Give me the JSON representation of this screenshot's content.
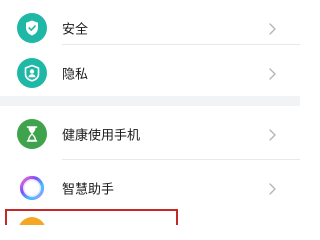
{
  "settings": {
    "items": [
      {
        "label": "安全",
        "icon": "shield-check-icon",
        "color": "#1fb8a6"
      },
      {
        "label": "隐私",
        "icon": "privacy-person-icon",
        "color": "#1fb8a6"
      },
      {
        "label": "健康使用手机",
        "icon": "hourglass-icon",
        "color": "#3fa34d"
      },
      {
        "label": "智慧助手",
        "icon": "smart-assistant-ring-icon",
        "color": "#7c4dff"
      }
    ],
    "partial_item": {
      "icon": "orange-circle-icon",
      "color": "#f5a623"
    }
  },
  "colors": {
    "section_gap": "#f1f3f5",
    "divider": "#e8e8e8",
    "highlight_border": "#c62828",
    "chevron": "#b5b5b5"
  }
}
